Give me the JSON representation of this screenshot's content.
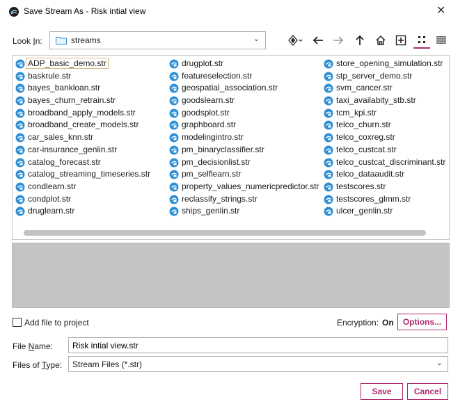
{
  "window": {
    "title": "Save Stream As - Risk intial view",
    "close_glyph": "✕"
  },
  "lookin": {
    "label_pre": "Look ",
    "label_ul": "I",
    "label_post": "n:",
    "value": "streams",
    "chevron": "⌄"
  },
  "toolbar": {
    "icons": [
      "location-diamond-icon",
      "back-arrow-icon",
      "forward-arrow-icon",
      "up-folder-icon",
      "home-icon",
      "new-folder-icon",
      "icon-view-icon",
      "list-view-icon"
    ],
    "active_view": "icon-view",
    "accent_color": "#b02a6e"
  },
  "files": {
    "col1": [
      "ADP_basic_demo.str",
      "baskrule.str",
      "bayes_bankloan.str",
      "bayes_churn_retrain.str",
      "broadband_apply_models.str",
      "broadband_create_models.str",
      "car_sales_knn.str",
      "car-insurance_genlin.str",
      "catalog_forecast.str",
      "catalog_streaming_timeseries.str",
      "condlearn.str",
      "condplot.str",
      "druglearn.str"
    ],
    "col2": [
      "drugplot.str",
      "featureselection.str",
      "geospatial_association.str",
      "goodslearn.str",
      "goodsplot.str",
      "graphboard.str",
      "modelingintro.str",
      "pm_binaryclassifier.str",
      "pm_decisionlist.str",
      "pm_selflearn.str",
      "property_values_numericpredictor.str",
      "reclassify_strings.str",
      "ships_genlin.str"
    ],
    "col3": [
      "store_opening_simulation.str",
      "stp_server_demo.str",
      "svm_cancer.str",
      "taxi_availabity_stb.str",
      "tcm_kpi.str",
      "telco_churn.str",
      "telco_coxreg.str",
      "telco_custcat.str",
      "telco_custcat_discriminant.str",
      "telco_dataaudit.str",
      "testscores.str",
      "testscores_glmm.str",
      "ulcer_genlin.str"
    ],
    "selected": "ADP_basic_demo.str",
    "icon": "stream-file-icon"
  },
  "options": {
    "add_to_project": "Add file to project",
    "add_checked": false,
    "encryption_label": "Encryption:",
    "encryption_value": "On",
    "options_button": "Options..."
  },
  "filename": {
    "label_pre": "File ",
    "label_ul": "N",
    "label_post": "ame:",
    "value": "Risk intial view.str"
  },
  "filetype": {
    "label_pre": "Files of ",
    "label_ul": "T",
    "label_post": "ype:",
    "value": "Stream Files (*.str)",
    "chevron": "⌄"
  },
  "buttons": {
    "save": "Save",
    "cancel": "Cancel"
  }
}
